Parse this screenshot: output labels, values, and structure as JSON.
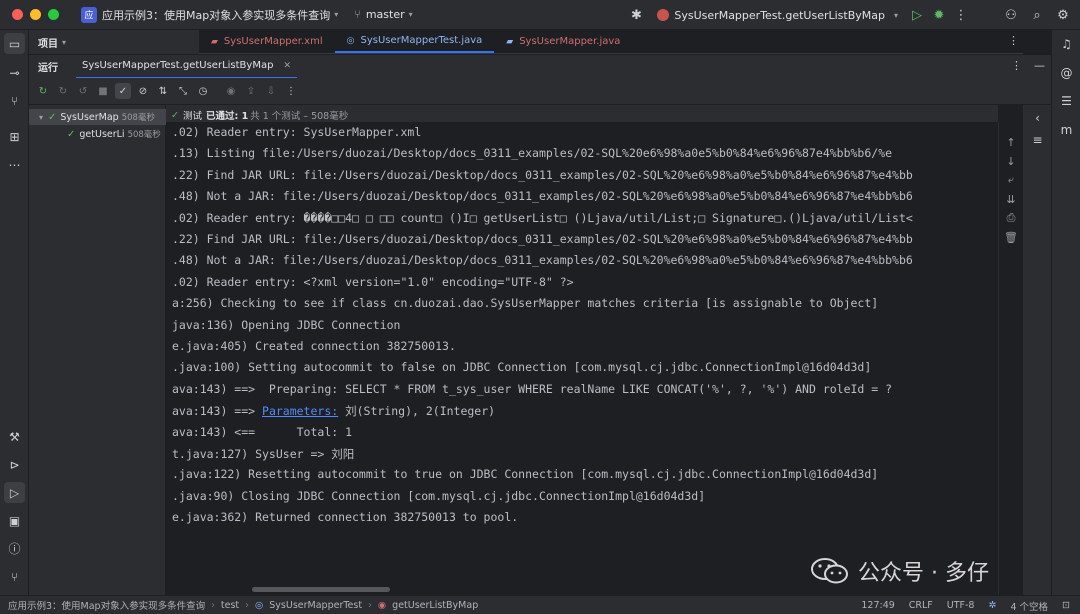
{
  "colors": {
    "traffic_close": "#ff5f57",
    "traffic_min": "#febc2e",
    "traffic_max": "#28c840",
    "project_badge": "#4a5fd6",
    "accent": "#3574f0",
    "success": "#5fb865",
    "link": "#548af7"
  },
  "titlebar": {
    "project_badge": "应",
    "project_name": "应用示例3：使用Map对象入参实现多条件查询",
    "branch": "master",
    "run_config": "SysUserMapperTest.getUserListByMap",
    "icons": [
      "bug-icon",
      "run-icon",
      "debug-icon",
      "more-icon",
      "add-user-icon",
      "search-icon",
      "settings-icon"
    ]
  },
  "project_panel": {
    "label": "项目"
  },
  "editor_tabs": [
    {
      "label": "SysUserMapper.xml"
    },
    {
      "label": "SysUserMapperTest.java"
    },
    {
      "label": "SysUserMapper.java"
    }
  ],
  "run_panel": {
    "label": "运行",
    "tab": "SysUserMapperTest.getUserListByMap",
    "status_prefix": "测试",
    "status_passed": "已通过: 1",
    "status_detail": "共 1 个测试 – 508毫秒"
  },
  "test_tree": [
    {
      "name": "SysUserMap",
      "time": "508毫秒"
    },
    {
      "name": "getUserLi",
      "time": "508毫秒"
    }
  ],
  "console_lines": [
    ".02) Reader entry: SysUserMapper.xml",
    ".13) Listing file:/Users/duozai/Desktop/docs_0311_examples/02-SQL%20e6%98%a0e5%b0%84%e6%96%87e4%bb%b6/%e",
    ".22) Find JAR URL: file:/Users/duozai/Desktop/docs_0311_examples/02-SQL%20%e6%98%a0%e5%b0%84%e6%96%87%e4%bb",
    ".48) Not a JAR: file:/Users/duozai/Desktop/docs_0311_examples/02-SQL%20%e6%98%a0%e5%b0%84%e6%96%87%e4%bb%b6",
    ".02) Reader entry: ����□□4□ □ □□ count□ ()I□ getUserList□ ()Ljava/util/List;□ Signature□.()Ljava/util/List<",
    ".22) Find JAR URL: file:/Users/duozai/Desktop/docs_0311_examples/02-SQL%20%e6%98%a0%e5%b0%84%e6%96%87%e4%bb",
    ".48) Not a JAR: file:/Users/duozai/Desktop/docs_0311_examples/02-SQL%20%e6%98%a0%e5%b0%84%e6%96%87%e4%bb%b6",
    ".02) Reader entry: <?xml version=\"1.0\" encoding=\"UTF-8\" ?>",
    "a:256) Checking to see if class cn.duozai.dao.SysUserMapper matches criteria [is assignable to Object]",
    "java:136) Opening JDBC Connection",
    "e.java:405) Created connection 382750013.",
    ".java:100) Setting autocommit to false on JDBC Connection [com.mysql.cj.jdbc.ConnectionImpl@16d04d3d]",
    "ava:143) ==>  Preparing: SELECT * FROM t_sys_user WHERE realName LIKE CONCAT('%', ?, '%') AND roleId = ?",
    {
      "pre": "ava:143) ==> ",
      "link": "Parameters:",
      "post": " 刘(String), 2(Integer)"
    },
    "ava:143) <==      Total: 1",
    "t.java:127) SysUser => 刘阳",
    ".java:122) Resetting autocommit to true on JDBC Connection [com.mysql.cj.jdbc.ConnectionImpl@16d04d3d]",
    ".java:90) Closing JDBC Connection [com.mysql.cj.jdbc.ConnectionImpl@16d04d3d]",
    "e.java:362) Returned connection 382750013 to pool."
  ],
  "watermark": "公众号 · 多仔",
  "statusbar": {
    "breadcrumbs": [
      "应用示例3：使用Map对象入参实现多条件查询",
      "test",
      "SysUserMapperTest",
      "getUserListByMap"
    ],
    "position": "127:49",
    "line_sep": "CRLF",
    "encoding": "UTF-8",
    "indent": "4 个空格"
  }
}
